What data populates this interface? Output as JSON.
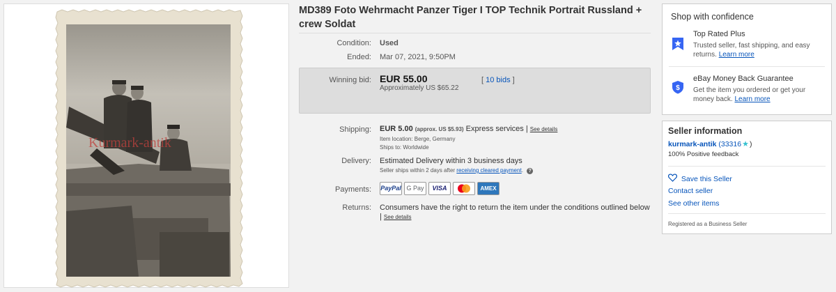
{
  "listing": {
    "title": "MD389 Foto Wehrmacht Panzer Tiger I TOP Technik Portrait Russland + crew Soldat",
    "photo_watermark": "Kurmark-antik"
  },
  "details": {
    "condition_label": "Condition:",
    "condition_value": "Used",
    "ended_label": "Ended:",
    "ended_value": "Mar 07, 2021, 9:50PM",
    "winning_bid_label": "Winning bid:",
    "winning_bid_value": "EUR 55.00",
    "winning_bid_approx": "Approximately US $65.22",
    "bids_open": "[",
    "bids_link": "10 bids",
    "bids_close": "]",
    "shipping_label": "Shipping:",
    "shipping_value": "EUR 5.00",
    "shipping_approx": "(approx. US $5.93)",
    "shipping_service": "Express services",
    "shipping_pipe": "|",
    "shipping_see_details": "See details",
    "item_location": "Item location:  Berge, Germany",
    "ships_to": "Ships to:  Worldwide",
    "delivery_label": "Delivery:",
    "delivery_value": "Estimated Delivery within 3 business days",
    "delivery_note": "Seller ships within 2 days after",
    "delivery_link": "receiving cleared payment",
    "delivery_end": ".",
    "payments_label": "Payments:",
    "payment_methods": [
      "PayPal",
      "G Pay",
      "VISA",
      "",
      "AMEX"
    ],
    "returns_label": "Returns:",
    "returns_value": "Consumers have the right to return the item under the conditions outlined below",
    "returns_pipe": "|",
    "returns_see_details": "See details"
  },
  "confidence": {
    "heading": "Shop with confidence",
    "top_rated_title": "Top Rated Plus",
    "top_rated_text": "Trusted seller, fast shipping, and easy returns.",
    "top_rated_link": "Learn more",
    "money_back_title": "eBay Money Back Guarantee",
    "money_back_text": "Get the item you ordered or get your money back.",
    "money_back_link": "Learn more"
  },
  "seller": {
    "heading": "Seller information",
    "name": "kurmark-antik",
    "feedback_open": "(33316",
    "feedback_close": ")",
    "positive": "100% Positive feedback",
    "save_label": "Save this Seller",
    "contact_label": "Contact seller",
    "other_items_label": "See other items",
    "registered": "Registered as a Business Seller"
  },
  "colors": {
    "link": "#0654ba",
    "badge_blue": "#3665f3",
    "star_teal": "#36c1d0"
  }
}
